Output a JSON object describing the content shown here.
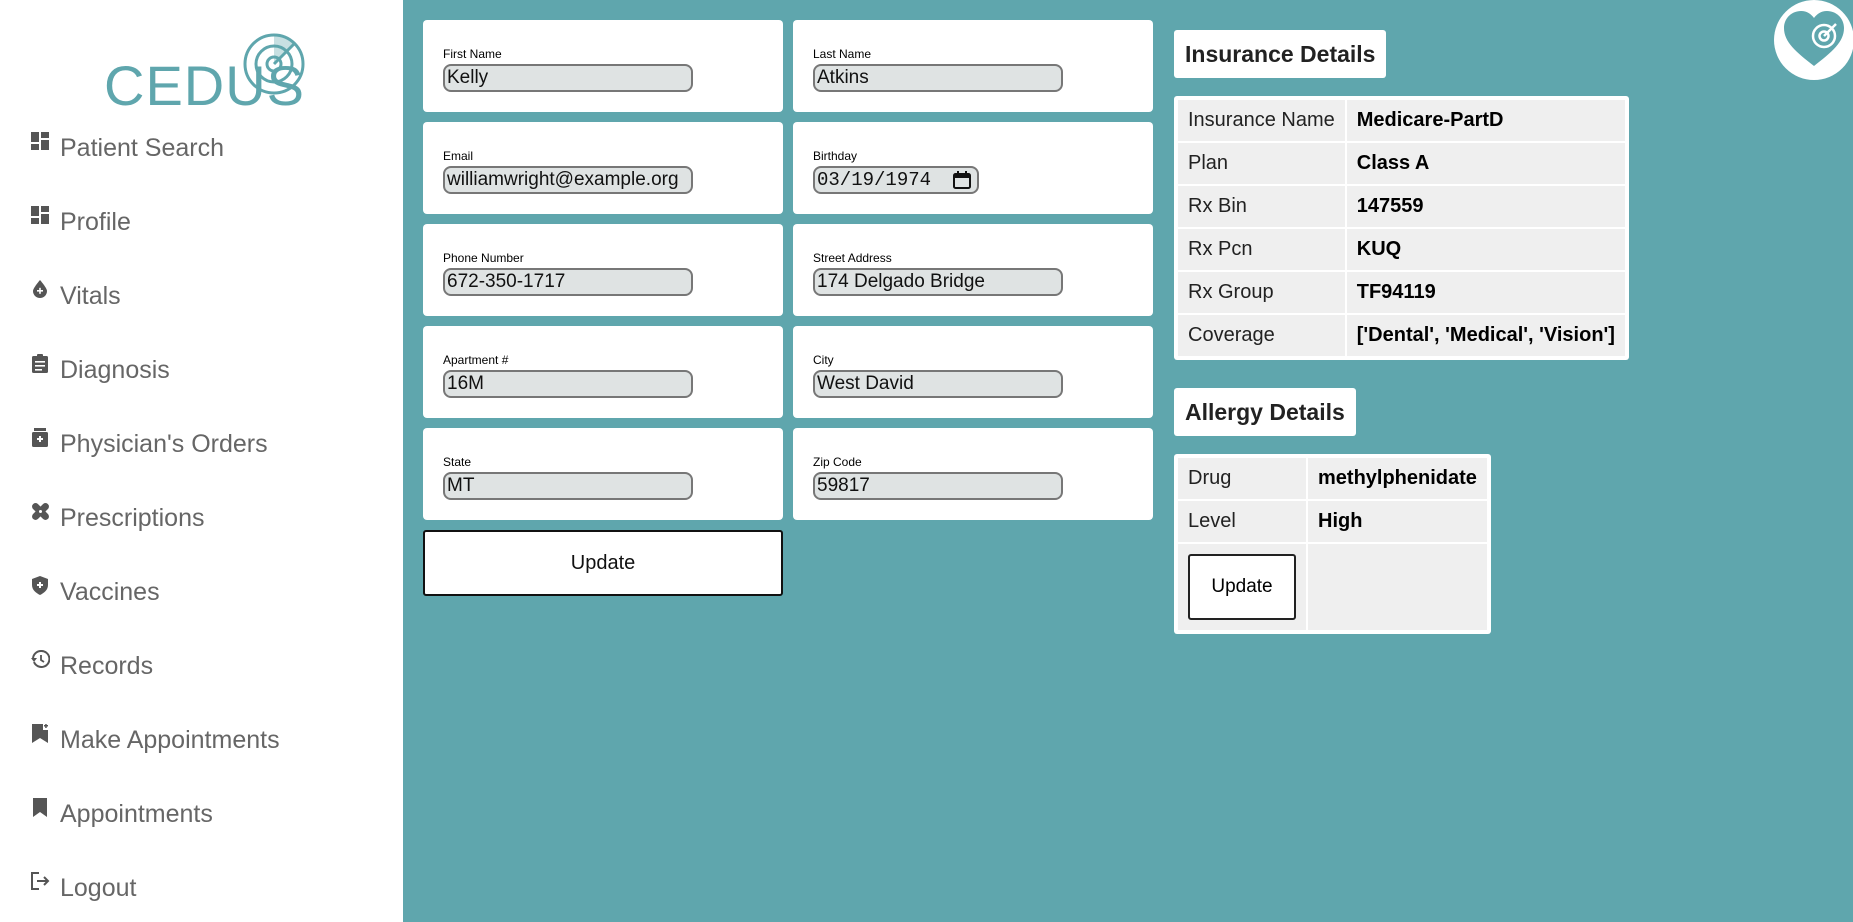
{
  "logo": {
    "text": "CEDUS"
  },
  "sidebar": {
    "items": [
      {
        "label": "Patient Search",
        "icon": "dashboard-icon"
      },
      {
        "label": "Profile",
        "icon": "dashboard-icon"
      },
      {
        "label": "Vitals",
        "icon": "blood-drop-icon"
      },
      {
        "label": "Diagnosis",
        "icon": "clipboard-icon"
      },
      {
        "label": "Physician's Orders",
        "icon": "medication-icon"
      },
      {
        "label": "Prescriptions",
        "icon": "bandage-icon"
      },
      {
        "label": "Vaccines",
        "icon": "shield-plus-icon"
      },
      {
        "label": "Records",
        "icon": "history-icon"
      },
      {
        "label": "Make Appointments",
        "icon": "bookmark-add-icon"
      },
      {
        "label": "Appointments",
        "icon": "bookmark-icon"
      },
      {
        "label": "Logout",
        "icon": "logout-icon"
      }
    ]
  },
  "form": {
    "first_name": {
      "label": "First Name",
      "value": "Kelly"
    },
    "last_name": {
      "label": "Last Name",
      "value": "Atkins"
    },
    "email": {
      "label": "Email",
      "value": "williamwright@example.org"
    },
    "birthday": {
      "label": "Birthday",
      "value": "03/19/1974"
    },
    "phone": {
      "label": "Phone Number",
      "value": "672-350-1717"
    },
    "street": {
      "label": "Street Address",
      "value": "174 Delgado Bridge"
    },
    "apartment": {
      "label": "Apartment #",
      "value": "16M"
    },
    "city": {
      "label": "City",
      "value": "West David"
    },
    "state": {
      "label": "State",
      "value": "MT"
    },
    "zip": {
      "label": "Zip Code",
      "value": "59817"
    },
    "update_label": "Update"
  },
  "insurance": {
    "title": "Insurance Details",
    "rows": [
      {
        "key": "Insurance Name",
        "value": "Medicare-PartD"
      },
      {
        "key": "Plan",
        "value": "Class A"
      },
      {
        "key": "Rx Bin",
        "value": "147559"
      },
      {
        "key": "Rx Pcn",
        "value": "KUQ"
      },
      {
        "key": "Rx Group",
        "value": "TF94119"
      },
      {
        "key": "Coverage",
        "value": "['Dental', 'Medical', 'Vision']"
      }
    ]
  },
  "allergy": {
    "title": "Allergy Details",
    "rows": [
      {
        "key": "Drug",
        "value": "methylphenidate"
      },
      {
        "key": "Level",
        "value": "High"
      }
    ],
    "update_label": "Update"
  },
  "colors": {
    "background": "#5fa6ad",
    "brand": "#5fa6ad"
  }
}
